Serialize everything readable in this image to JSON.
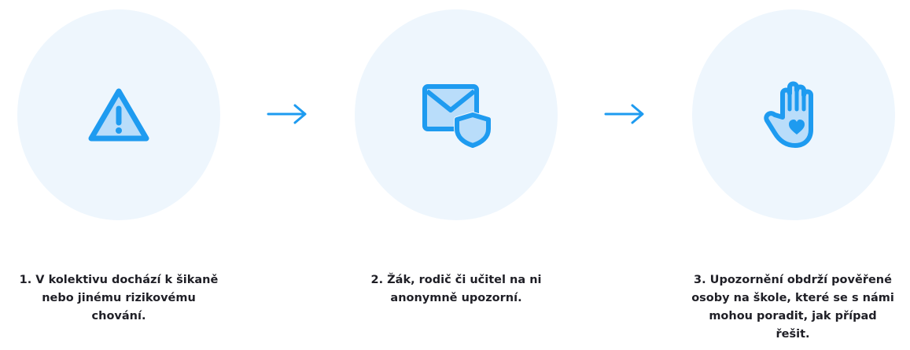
{
  "steps": [
    {
      "icon": "warning-icon",
      "lines": [
        "1. V kolektivu dochází k šikaně",
        "nebo jinému rizikovému",
        "chování."
      ]
    },
    {
      "icon": "secure-mail-icon",
      "lines": [
        "2. Žák, rodič či učitel na ni",
        "anonymně upozorní."
      ]
    },
    {
      "icon": "hand-heart-icon",
      "lines": [
        "3. Upozornění obdrží pověřené",
        "osoby na škole, které se s námi",
        "mohou poradit, jak případ",
        "řešit."
      ]
    }
  ],
  "arrows": [
    "arrow-right-icon",
    "arrow-right-icon"
  ],
  "colors": {
    "accent": "#1e9bf0",
    "circle_bg": "#eef6fd",
    "icon_fill": "#b9ddfa",
    "text": "#1f1f26"
  }
}
